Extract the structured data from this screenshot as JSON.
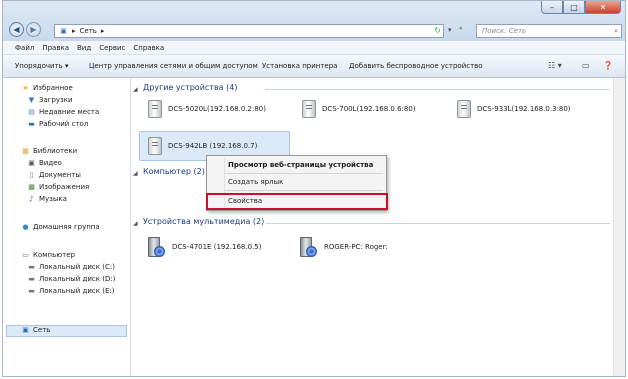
{
  "address": {
    "breadcrumb_root_icon": "network-icon",
    "location": "Сеть"
  },
  "search": {
    "placeholder": "Поиск: Сеть"
  },
  "window_buttons": {
    "minimize": "–",
    "maximize": "□",
    "close": "✕"
  },
  "menu": [
    "Файл",
    "Правка",
    "Вид",
    "Сервис",
    "Справка"
  ],
  "commands": {
    "organize": "Упорядочить ▾",
    "network_center": "Центр управления сетями и общим доступом",
    "add_printer": "Установка принтера",
    "add_wireless": "Добавить беспроводное устройство"
  },
  "nav": {
    "favorites": "Избранное",
    "downloads": "Загрузки",
    "recent": "Недавние места",
    "desktop": "Рабочий стол",
    "libraries": "Библиотеки",
    "video": "Видео",
    "documents": "Документы",
    "images": "Изображения",
    "music": "Музыка",
    "homegroup": "Домашняя группа",
    "computer": "Компьютер",
    "disk_c": "Локальный диск (C:)",
    "disk_d": "Локальный диск (D:)",
    "disk_e": "Локальный диск (E:)",
    "network": "Сеть"
  },
  "groups": {
    "other": "Другие устройства (4)",
    "computer": "Компьютер (2)",
    "multimedia": "Устройства мультимедиа (2)"
  },
  "devices": {
    "d1": "DCS-5020L(192.168.0.2:80)",
    "d2": "DCS-700L(192.168.0.6:80)",
    "d3": "DCS-933L(192.168.0.3:80)",
    "d4": "DCS-942LB (192.168.0.7)",
    "m1": "DCS-4701E (192.168.0.5)",
    "m2": "ROGER-PC: Roger:"
  },
  "context_menu": {
    "view_web": "Просмотр веб-страницы устройства",
    "create_shortcut": "Создать ярлык",
    "properties": "Свойства"
  },
  "colors": {
    "highlight": "#c8102e",
    "selection": "#dce9f7"
  }
}
